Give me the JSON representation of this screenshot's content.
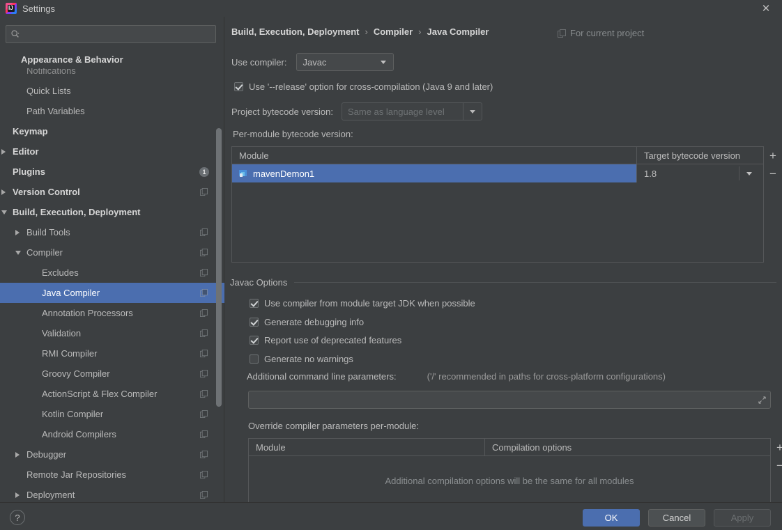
{
  "window": {
    "title": "Settings",
    "app_icon": "intellij-idea-icon",
    "close_label": "✕"
  },
  "search": {
    "value": "",
    "placeholder": "",
    "icon": "search-icon"
  },
  "sidebar": {
    "items": [
      {
        "label": "Appearance & Behavior",
        "level": 0,
        "bold": true,
        "arrow": "none",
        "sticky": true
      },
      {
        "label": "Notifications",
        "level": 1,
        "bold": false,
        "arrow": "none",
        "clipped": true
      },
      {
        "label": "Quick Lists",
        "level": 1,
        "bold": false,
        "arrow": "none"
      },
      {
        "label": "Path Variables",
        "level": 1,
        "bold": false,
        "arrow": "none"
      },
      {
        "label": "Keymap",
        "level": 0,
        "bold": true,
        "arrow": "none"
      },
      {
        "label": "Editor",
        "level": 0,
        "bold": true,
        "arrow": "right"
      },
      {
        "label": "Plugins",
        "level": 0,
        "bold": true,
        "arrow": "none",
        "badge": "1"
      },
      {
        "label": "Version Control",
        "level": 0,
        "bold": true,
        "arrow": "right",
        "copy": true
      },
      {
        "label": "Build, Execution, Deployment",
        "level": 0,
        "bold": true,
        "arrow": "down"
      },
      {
        "label": "Build Tools",
        "level": 1,
        "bold": false,
        "arrow": "right",
        "copy": true
      },
      {
        "label": "Compiler",
        "level": 1,
        "bold": false,
        "arrow": "down",
        "copy": true
      },
      {
        "label": "Excludes",
        "level": 2,
        "bold": false,
        "arrow": "none",
        "copy": true
      },
      {
        "label": "Java Compiler",
        "level": 2,
        "bold": false,
        "arrow": "none",
        "copy": true,
        "selected": true
      },
      {
        "label": "Annotation Processors",
        "level": 2,
        "bold": false,
        "arrow": "none",
        "copy": true
      },
      {
        "label": "Validation",
        "level": 2,
        "bold": false,
        "arrow": "none",
        "copy": true
      },
      {
        "label": "RMI Compiler",
        "level": 2,
        "bold": false,
        "arrow": "none",
        "copy": true
      },
      {
        "label": "Groovy Compiler",
        "level": 2,
        "bold": false,
        "arrow": "none",
        "copy": true
      },
      {
        "label": "ActionScript & Flex Compiler",
        "level": 2,
        "bold": false,
        "arrow": "none",
        "copy": true
      },
      {
        "label": "Kotlin Compiler",
        "level": 2,
        "bold": false,
        "arrow": "none",
        "copy": true
      },
      {
        "label": "Android Compilers",
        "level": 2,
        "bold": false,
        "arrow": "none",
        "copy": true
      },
      {
        "label": "Debugger",
        "level": 1,
        "bold": false,
        "arrow": "right",
        "copy": true
      },
      {
        "label": "Remote Jar Repositories",
        "level": 1,
        "bold": false,
        "arrow": "none",
        "copy": true
      },
      {
        "label": "Deployment",
        "level": 1,
        "bold": false,
        "arrow": "right",
        "copy": true
      }
    ]
  },
  "breadcrumb": {
    "part1": "Build, Execution, Deployment",
    "sep1": "›",
    "part2": "Compiler",
    "sep2": "›",
    "part3": "Java Compiler",
    "scope_label": "For current project",
    "scope_icon": "copy-settings-icon"
  },
  "compiler": {
    "use_compiler_label": "Use compiler:",
    "use_compiler_value": "Javac",
    "release_option_label": "Use '--release' option for cross-compilation (Java 9 and later)",
    "release_option_checked": true,
    "project_bytecode_label": "Project bytecode version:",
    "project_bytecode_value": "Same as language level",
    "project_bytecode_disabled": true,
    "per_module_label": "Per-module bytecode version:"
  },
  "module_table": {
    "columns": [
      "Module",
      "Target bytecode version"
    ],
    "rows": [
      {
        "module": "mavenDemon1",
        "target": "1.8",
        "selected": true,
        "icon": "module-icon"
      }
    ],
    "add_label": "+",
    "remove_label": "−"
  },
  "javac_options": {
    "section_title": "Javac Options",
    "checkboxes": [
      {
        "label": "Use compiler from module target JDK when possible",
        "checked": true
      },
      {
        "label": "Generate debugging info",
        "checked": true
      },
      {
        "label": "Report use of deprecated features",
        "checked": true
      },
      {
        "label": "Generate no warnings",
        "checked": false
      }
    ],
    "additional_params_label": "Additional command line parameters:",
    "additional_params_hint": "('/' recommended in paths for cross-platform configurations)",
    "additional_params_value": "",
    "expand_icon": "expand-field-icon",
    "override_label": "Override compiler parameters per-module:",
    "override_columns": [
      "Module",
      "Compilation options"
    ],
    "override_empty_note": "Additional compilation options will be the same for all modules",
    "override_add_label": "+",
    "override_remove_label": "−"
  },
  "footer": {
    "help_label": "?",
    "ok_label": "OK",
    "cancel_label": "Cancel",
    "apply_label": "Apply",
    "apply_disabled": true
  },
  "colors": {
    "accent_blue": "#4b6eaf",
    "window_bg": "#3c3f41",
    "field_bg": "#45484a",
    "text": "#bbbbbb"
  }
}
